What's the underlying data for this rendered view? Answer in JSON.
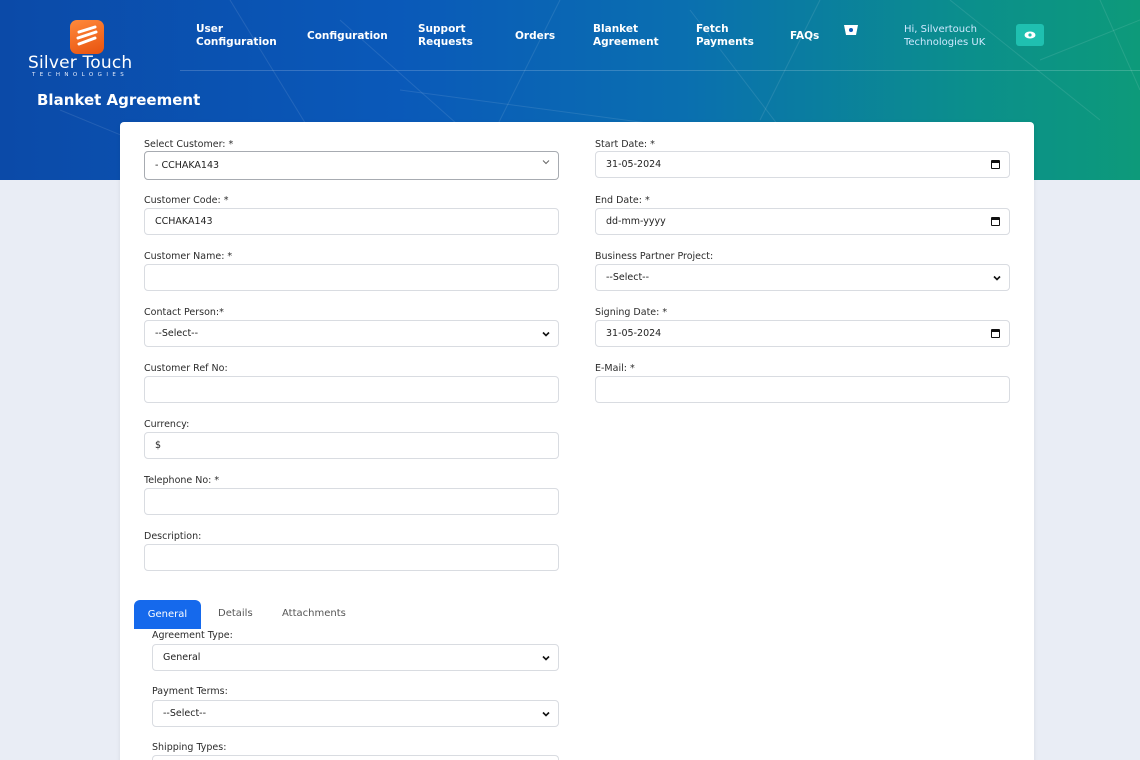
{
  "brand": {
    "name": "Silver Touch",
    "tagline": "TECHNOLOGIES"
  },
  "nav": {
    "user_config": [
      "User",
      "Configuration"
    ],
    "configuration": "Configuration",
    "support": [
      "Support",
      "Requests"
    ],
    "orders": "Orders",
    "blanket": [
      "Blanket",
      "Agreement"
    ],
    "fetch": [
      "Fetch",
      "Payments"
    ],
    "faqs": "FAQs",
    "cart_icon": "cart-icon",
    "greeting": [
      "Hi, Silvertouch",
      "Technologies UK"
    ],
    "eye_icon": "eye-icon"
  },
  "page": {
    "title": "Blanket Agreement"
  },
  "form": {
    "select_customer": {
      "label": "Select Customer: *",
      "value": "- CCHAKA143"
    },
    "customer_code": {
      "label": "Customer Code: *",
      "value": "CCHAKA143"
    },
    "customer_name": {
      "label": "Customer Name: *",
      "value": ""
    },
    "contact_person": {
      "label": "Contact Person:*",
      "value": "--Select--"
    },
    "customer_ref": {
      "label": "Customer Ref No:",
      "value": ""
    },
    "currency": {
      "label": "Currency:",
      "value": "$"
    },
    "telephone": {
      "label": "Telephone No: *",
      "value": ""
    },
    "description": {
      "label": "Description:",
      "value": ""
    },
    "start_date": {
      "label": "Start Date: *",
      "value": "31-05-2024"
    },
    "end_date": {
      "label": "End Date: *",
      "value": "dd-mm-yyyy"
    },
    "bp_project": {
      "label": "Business Partner Project:",
      "value": "--Select--"
    },
    "signing_date": {
      "label": "Signing Date: *",
      "value": "31-05-2024"
    },
    "email": {
      "label": "E-Mail: *",
      "value": ""
    }
  },
  "tabs": [
    "General",
    "Details",
    "Attachments"
  ],
  "general": {
    "agreement_type": {
      "label": "Agreement Type:",
      "value": "General"
    },
    "payment_terms": {
      "label": "Payment Terms:",
      "value": "--Select--"
    },
    "shipping_types": {
      "label": "Shipping Types:",
      "value": ""
    }
  },
  "colors": {
    "accent": "#1569ec",
    "eye_button": "#1fc0b0",
    "logo": "#f26a1b"
  }
}
